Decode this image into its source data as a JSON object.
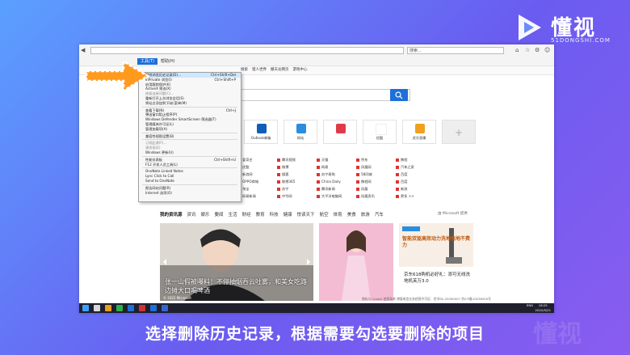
{
  "logo": {
    "brand": "懂视",
    "domain": "51DONGSHI.COM"
  },
  "browser": {
    "address": "",
    "search_placeholder": "搜索...",
    "menubar": [
      "工具(T)",
      "帮助(H)"
    ],
    "favorites": [
      "搜索",
      "猎人世界",
      "撤天龙网页",
      "游戏中心"
    ]
  },
  "tools_menu": {
    "items": [
      {
        "label": "删除浏览历史记录(D)...",
        "shortcut": "Ctrl+Shift+Del",
        "highlight": true
      },
      {
        "label": "InPrivate 浏览(I)",
        "shortcut": "Ctrl+Shift+P"
      },
      {
        "label": "启用跟踪保护(K)"
      },
      {
        "label": "ActiveX 筛选(X)"
      },
      {
        "label": "修复连接问题(C)...",
        "disabled": true
      },
      {
        "label": "重新打开上次浏览会话(S)"
      },
      {
        "label": "将站点添加到'开始'菜单(M)"
      },
      {
        "sep": true
      },
      {
        "label": "查看下载(N)",
        "shortcut": "Ctrl+J"
      },
      {
        "label": "弹出窗口阻止程序(P)"
      },
      {
        "label": "Windows Defender SmartScreen 筛选器(T)"
      },
      {
        "label": "管理媒体许可证(L)"
      },
      {
        "label": "管理加载项(A)"
      },
      {
        "sep": true
      },
      {
        "label": "兼容性视图设置(B)"
      },
      {
        "sep": true
      },
      {
        "label": "订阅此源(F)...",
        "disabled": true
      },
      {
        "label": "源发现(E)",
        "disabled": true
      },
      {
        "label": "Windows 更新(U)"
      },
      {
        "sep": true
      },
      {
        "label": "性能仪表板",
        "shortcut": "Ctrl+Shift+U"
      },
      {
        "label": "F12 开发人员工具(L)"
      },
      {
        "sep": true
      },
      {
        "label": "OneNote Linked Notes"
      },
      {
        "label": "Lync Click to Call"
      },
      {
        "label": "Send to OneNote"
      },
      {
        "sep": true
      },
      {
        "label": "报告网站问题(R)"
      },
      {
        "label": "Internet 选项(O)"
      }
    ]
  },
  "tiles": [
    {
      "label": "Outlook邮箱",
      "color": "#0f5fb8"
    },
    {
      "label": "网站",
      "color": "#2b8de0"
    },
    {
      "label": "",
      "color": "#e03a4a"
    },
    {
      "label": "优酷",
      "color": "#ffffff"
    },
    {
      "label": "虎牙直播",
      "color": "#f0a020"
    },
    {
      "label": "+",
      "color": "#eeeeee"
    }
  ],
  "links": [
    "爱奇艺",
    "腾讯视频",
    "天猫",
    "京东",
    "携程",
    "优酷",
    "微博",
    "网易",
    "凤凰网",
    "汽车之家",
    "新浪网",
    "搜狐",
    "苏宁易购",
    "58同城",
    "百度",
    "OPPO商城",
    "联想365",
    "China Daily",
    "携程网",
    "百度",
    "淘宝",
    "苏宁",
    "腾讯新闻",
    "凤凰",
    "新浪",
    "网易新闻",
    "中华网",
    "大平洋电脑网",
    "凤凰资讯",
    "更多 >>"
  ],
  "news": {
    "nav": [
      "我的资讯源",
      "资讯",
      "娱乐",
      "要闻",
      "生活",
      "财经",
      "教育",
      "科技",
      "健康",
      "悦读天下",
      "航空",
      "体育",
      "美食",
      "旅游",
      "汽车"
    ],
    "ms": "由 Microsoft 提供",
    "card1_caption": "张一山假被曝料！不停抽烟吞云吐雾，和美女吃路边摊大口喝啤酒",
    "card1_copy": "© 2022 Microsoft",
    "card2_caption": "",
    "card3_ad": "智能双驱高效动力洗地拖地不费力",
    "card3b_caption": "京东618购机必好礼：添可无线洗地机芙万3.0",
    "footer": "隐私与 Cookie   使用条款   增值电信业务经营许可证：合字B2-20090007   京ICP备10036305号"
  },
  "tray": {
    "time": "18:25",
    "date": "2022/5/21",
    "lang": "ENG"
  },
  "subtitle": "选择删除历史记录，根据需要勾选要删除的项目",
  "watermark": "懂视"
}
